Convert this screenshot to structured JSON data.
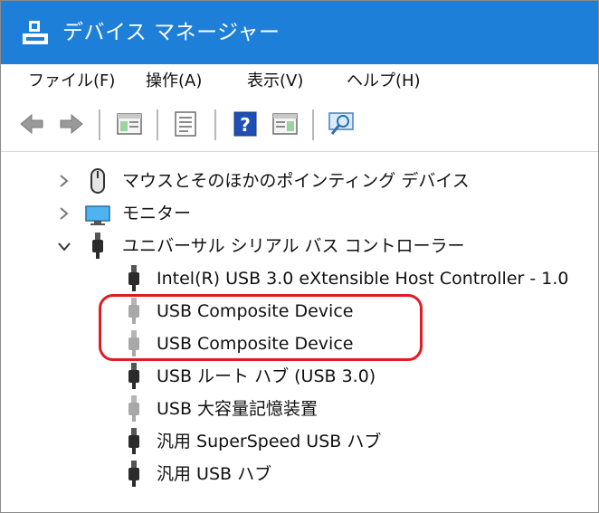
{
  "window": {
    "title": "デバイス マネージャー"
  },
  "menu": [
    {
      "label": "ファイル(F)"
    },
    {
      "label": "操作(A)"
    },
    {
      "label": "表示(V)"
    },
    {
      "label": "ヘルプ(H)"
    }
  ],
  "toolbar_icons": [
    "back-arrow-icon",
    "forward-arrow-icon",
    "show-hide-console-tree-icon",
    "properties-icon",
    "help-icon",
    "action-pane-icon",
    "scan-hardware-icon"
  ],
  "tree": {
    "categories": [
      {
        "label": "マウスとそのほかのポインティング デバイス",
        "expanded": false,
        "icon": "mouse-icon"
      },
      {
        "label": "モニター",
        "expanded": false,
        "icon": "monitor-icon"
      },
      {
        "label": "ユニバーサル シリアル バス コントローラー",
        "expanded": true,
        "icon": "usb-plug-icon"
      }
    ],
    "usb_devices": [
      {
        "label": "Intel(R) USB 3.0 eXtensible Host Controller - 1.0",
        "icon": "usb-plug-icon",
        "disabled": false
      },
      {
        "label": "USB Composite Device",
        "icon": "usb-plug-icon",
        "disabled": true
      },
      {
        "label": "USB Composite Device",
        "icon": "usb-plug-icon",
        "disabled": true
      },
      {
        "label": "USB ルート ハブ (USB 3.0)",
        "icon": "usb-plug-icon",
        "disabled": false
      },
      {
        "label": "USB 大容量記憶装置",
        "icon": "usb-plug-icon",
        "disabled": true
      },
      {
        "label": "汎用 SuperSpeed USB ハブ",
        "icon": "usb-plug-icon",
        "disabled": false
      },
      {
        "label": "汎用 USB ハブ",
        "icon": "usb-plug-icon",
        "disabled": false
      }
    ]
  },
  "colors": {
    "titlebar": "#1e7fd8",
    "highlight": "#e01b24"
  }
}
